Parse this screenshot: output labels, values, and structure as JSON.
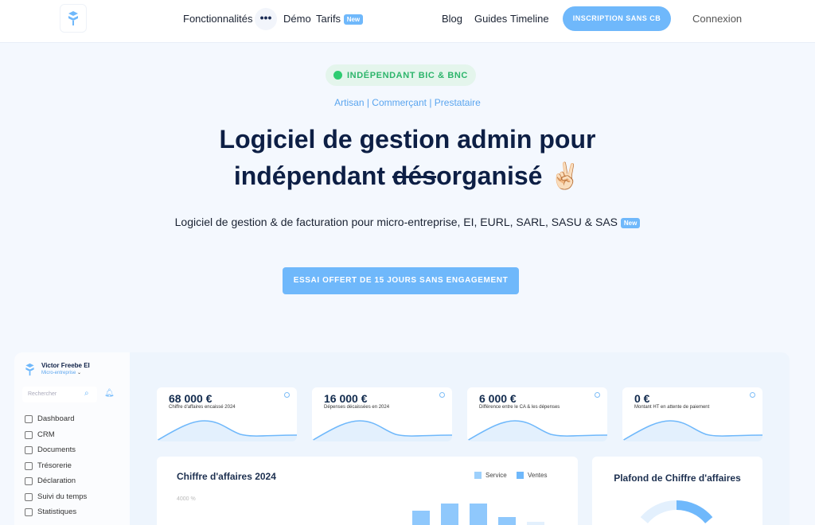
{
  "nav": {
    "links": [
      "Fonctionnalités",
      "Démo",
      "Tarifs"
    ],
    "new_badge": "New",
    "right_links": [
      "Blog",
      "Guides",
      "Timeline"
    ],
    "signup": "INSCRIPTION SANS CB",
    "login": "Connexion",
    "more_icon": "ellipsis-icon"
  },
  "hero": {
    "badge": "INDÉPENDANT BIC & BNC",
    "subtitle": "Artisan | Commerçant | Prestataire",
    "title_line1": "Logiciel de gestion admin pour",
    "title_pre": "indépendant ",
    "title_strike": "dés",
    "title_post": "organisé ✌🏻",
    "description": "Logiciel de gestion & de facturation pour micro-entreprise, EI, EURL, SARL, SASU & SAS",
    "desc_badge": "New",
    "cta": "ESSAI OFFERT DE 15 JOURS SANS ENGAGEMENT"
  },
  "app": {
    "user": "Victor Freebe EI",
    "type": "Micro-entreprise",
    "search_placeholder": "Rechercher",
    "menu": [
      "Dashboard",
      "CRM",
      "Documents",
      "Trésorerie",
      "Déclaration",
      "Suivi du temps",
      "Statistiques"
    ],
    "cards": [
      {
        "value": "68 000 €",
        "label": "Chiffre d'affaires encaissé 2024"
      },
      {
        "value": "16 000 €",
        "label": "Dépenses décaissées en 2024"
      },
      {
        "value": "6 000 €",
        "label": "Différence entre le CA & les dépenses"
      },
      {
        "value": "0 €",
        "label": "Montant HT en attente de paiement"
      }
    ],
    "chart_title": "Chiffre d'affaires 2024",
    "chart_tick": "4000 %",
    "legend": [
      "Service",
      "Ventes"
    ],
    "ceiling_title": "Plafond de Chiffre d'affaires"
  },
  "colors": {
    "accent": "#6fb8fb",
    "navy": "#0d1f45",
    "green": "#2ecc71"
  }
}
